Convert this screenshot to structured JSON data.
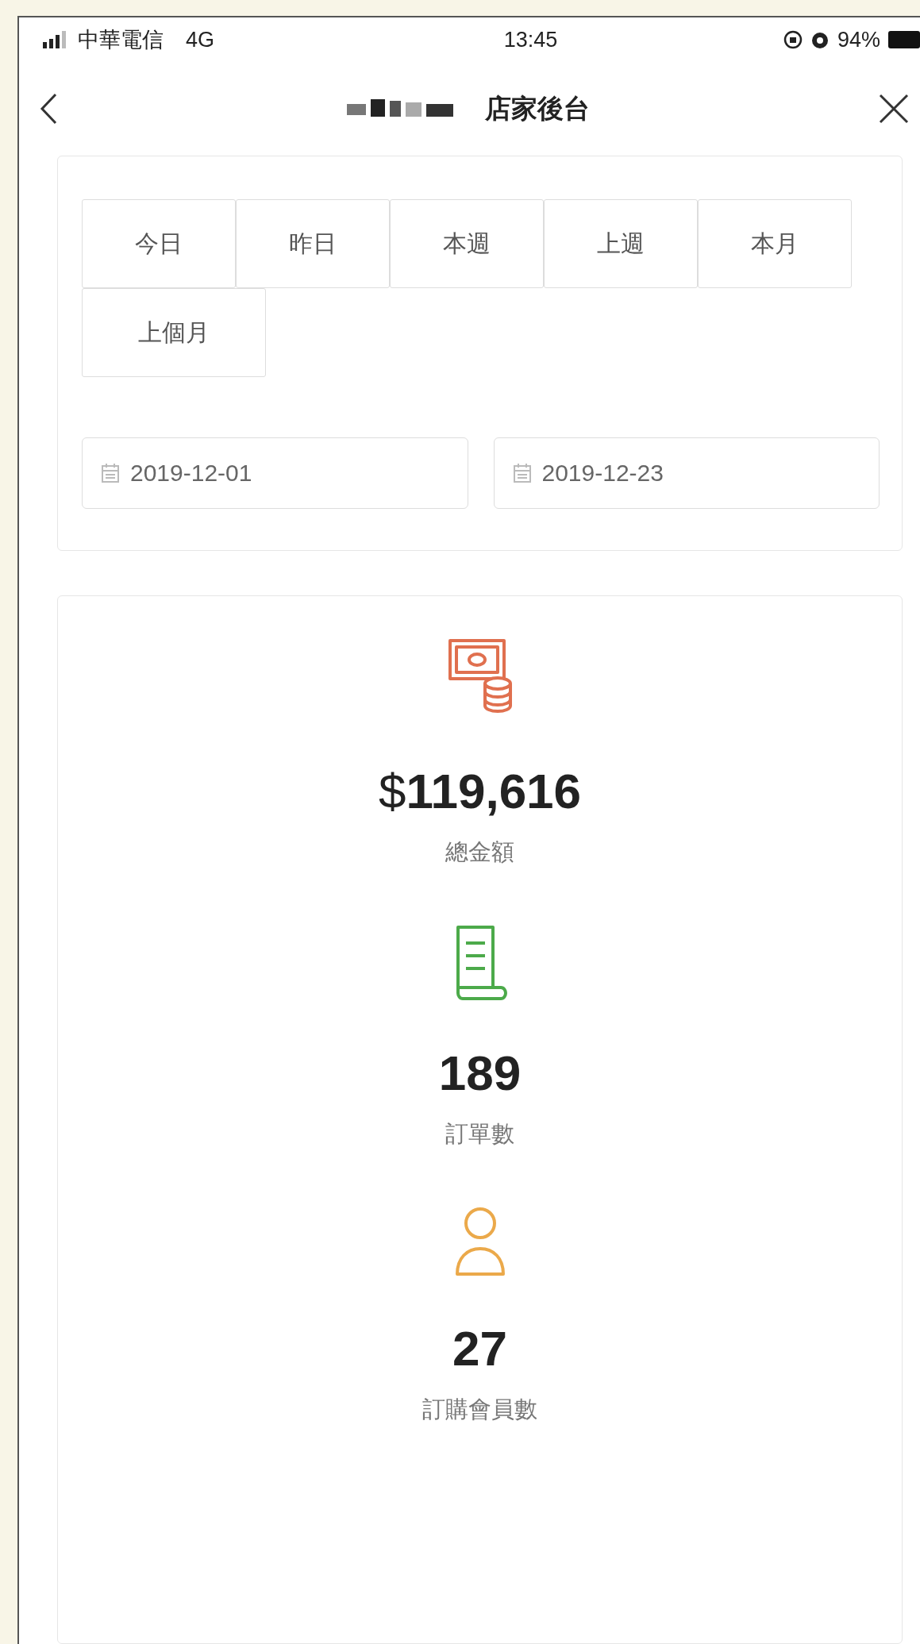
{
  "status_bar": {
    "carrier": "中華電信",
    "network": "4G",
    "time": "13:45",
    "battery": "94%"
  },
  "header": {
    "title": "店家後台"
  },
  "range_tabs": [
    {
      "label": "今日"
    },
    {
      "label": "昨日"
    },
    {
      "label": "本週"
    },
    {
      "label": "上週"
    },
    {
      "label": "本月"
    },
    {
      "label": "上個月"
    }
  ],
  "date_fields": [
    {
      "value": "2019-12-01"
    },
    {
      "value": "2019-12-23"
    }
  ],
  "stats": [
    {
      "kind": "money",
      "color": "#e0704f",
      "value": "$**119,616**",
      "label": "總金額"
    },
    {
      "kind": "receipt",
      "color": "#4caa4a",
      "value": "189",
      "label": "訂單數"
    },
    {
      "kind": "member",
      "color": "#eba94a",
      "value": "27",
      "label": "訂購會員數"
    }
  ]
}
